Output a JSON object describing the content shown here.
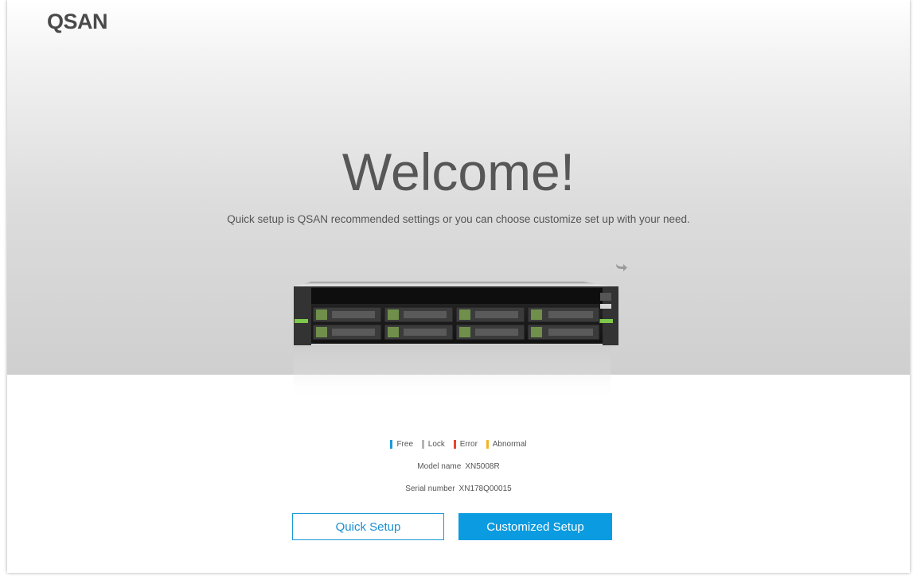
{
  "brand": {
    "logo_text": "QSAN",
    "accent_color": "#0a9be0"
  },
  "hero": {
    "title": "Welcome!",
    "subtitle": "Quick setup is QSAN recommended settings or you can choose customize set up with your need.",
    "share_icon": "share-arrow-icon"
  },
  "legend": {
    "items": [
      {
        "label": "Free",
        "color": "#1a9ad8"
      },
      {
        "label": "Lock",
        "color": "#b5b5b5"
      },
      {
        "label": "Error",
        "color": "#e8472b"
      },
      {
        "label": "Abnormal",
        "color": "#f5b324"
      }
    ]
  },
  "device_info": {
    "model_label": "Model name",
    "model_value": "XN5008R",
    "serial_label": "Serial number",
    "serial_value": "XN178Q00015"
  },
  "actions": {
    "quick_setup_label": "Quick Setup",
    "customized_setup_label": "Customized Setup"
  }
}
